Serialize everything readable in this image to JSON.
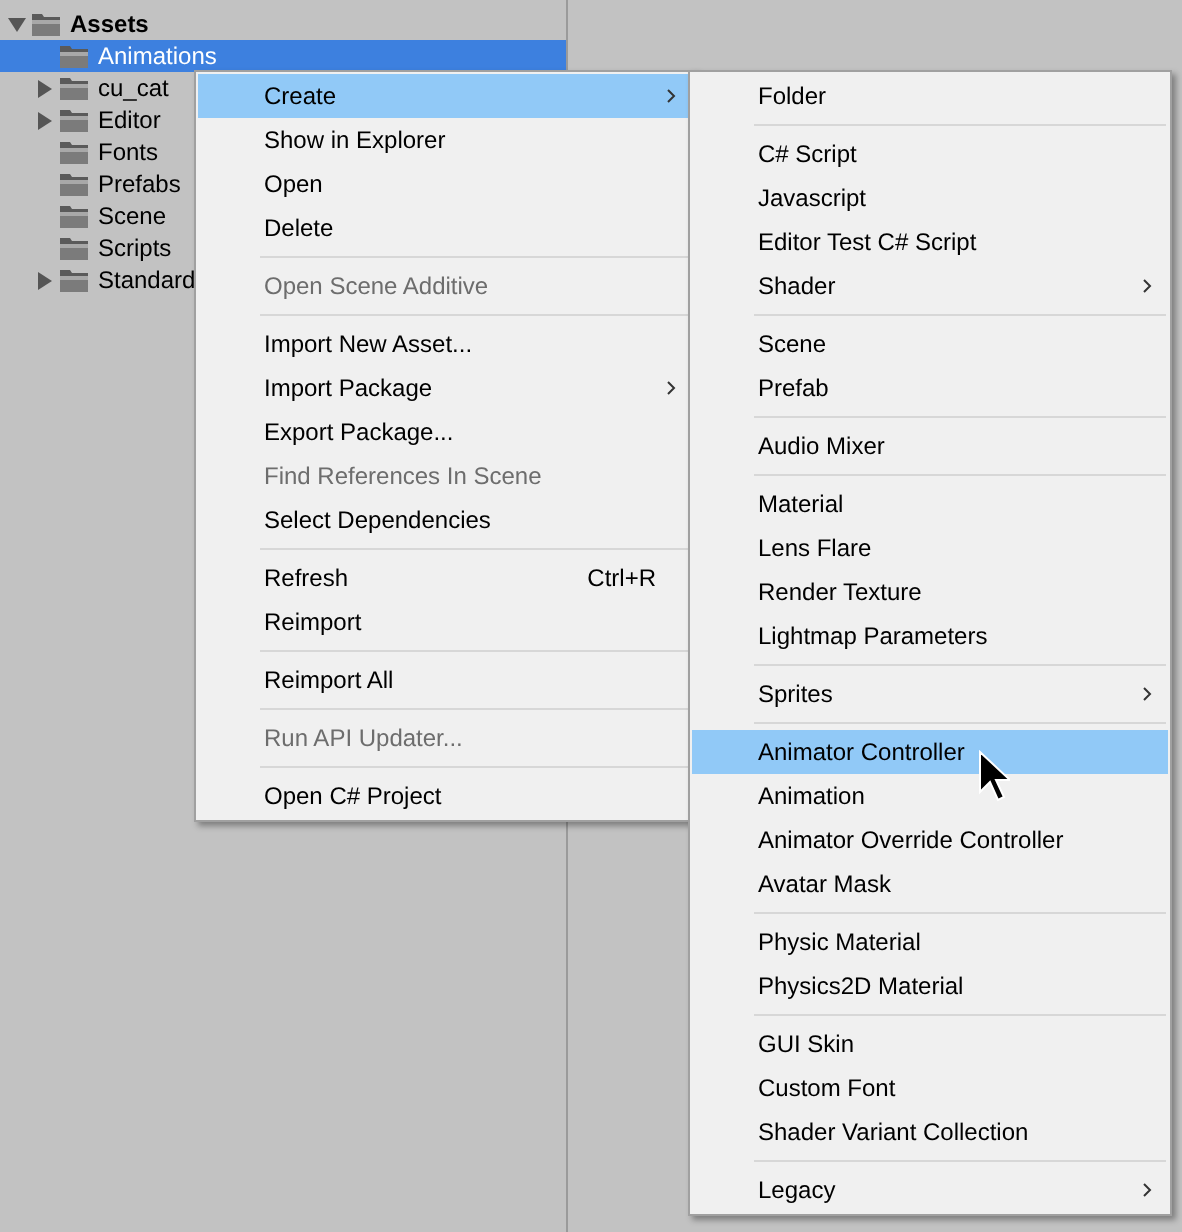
{
  "tree": [
    {
      "label": "Assets",
      "has_children": true,
      "expanded": true,
      "selected": false,
      "children": [
        {
          "label": "Animations",
          "has_children": false,
          "selected": true
        },
        {
          "label": "cu_cat",
          "has_children": true,
          "expanded": false,
          "selected": false
        },
        {
          "label": "Editor",
          "has_children": true,
          "expanded": false,
          "selected": false
        },
        {
          "label": "Fonts",
          "has_children": false,
          "selected": false
        },
        {
          "label": "Prefabs",
          "has_children": false,
          "selected": false
        },
        {
          "label": "Scene",
          "has_children": false,
          "selected": false
        },
        {
          "label": "Scripts",
          "has_children": false,
          "selected": false
        },
        {
          "label": "Standard",
          "has_children": true,
          "expanded": false,
          "selected": false
        }
      ]
    }
  ],
  "context_menu": {
    "items": [
      {
        "kind": "item",
        "label": "Create",
        "submenu": true,
        "disabled": false,
        "selected": true
      },
      {
        "kind": "item",
        "label": "Show in Explorer",
        "submenu": false,
        "disabled": false,
        "selected": false
      },
      {
        "kind": "item",
        "label": "Open",
        "submenu": false,
        "disabled": false,
        "selected": false
      },
      {
        "kind": "item",
        "label": "Delete",
        "submenu": false,
        "disabled": false,
        "selected": false
      },
      {
        "kind": "separator"
      },
      {
        "kind": "item",
        "label": "Open Scene Additive",
        "submenu": false,
        "disabled": true,
        "selected": false
      },
      {
        "kind": "separator"
      },
      {
        "kind": "item",
        "label": "Import New Asset...",
        "submenu": false,
        "disabled": false,
        "selected": false
      },
      {
        "kind": "item",
        "label": "Import Package",
        "submenu": true,
        "disabled": false,
        "selected": false
      },
      {
        "kind": "item",
        "label": "Export Package...",
        "submenu": false,
        "disabled": false,
        "selected": false
      },
      {
        "kind": "item",
        "label": "Find References In Scene",
        "submenu": false,
        "disabled": true,
        "selected": false
      },
      {
        "kind": "item",
        "label": "Select Dependencies",
        "submenu": false,
        "disabled": false,
        "selected": false
      },
      {
        "kind": "separator"
      },
      {
        "kind": "item",
        "label": "Refresh",
        "shortcut": "Ctrl+R",
        "submenu": false,
        "disabled": false,
        "selected": false
      },
      {
        "kind": "item",
        "label": "Reimport",
        "submenu": false,
        "disabled": false,
        "selected": false
      },
      {
        "kind": "separator"
      },
      {
        "kind": "item",
        "label": "Reimport All",
        "submenu": false,
        "disabled": false,
        "selected": false
      },
      {
        "kind": "separator"
      },
      {
        "kind": "item",
        "label": "Run API Updater...",
        "submenu": false,
        "disabled": true,
        "selected": false
      },
      {
        "kind": "separator"
      },
      {
        "kind": "item",
        "label": "Open C# Project",
        "submenu": false,
        "disabled": false,
        "selected": false
      }
    ]
  },
  "create_submenu": {
    "items": [
      {
        "kind": "item",
        "label": "Folder",
        "submenu": false,
        "disabled": false,
        "selected": false
      },
      {
        "kind": "separator"
      },
      {
        "kind": "item",
        "label": "C# Script",
        "submenu": false,
        "disabled": false,
        "selected": false
      },
      {
        "kind": "item",
        "label": "Javascript",
        "submenu": false,
        "disabled": false,
        "selected": false
      },
      {
        "kind": "item",
        "label": "Editor Test C# Script",
        "submenu": false,
        "disabled": false,
        "selected": false
      },
      {
        "kind": "item",
        "label": "Shader",
        "submenu": true,
        "disabled": false,
        "selected": false
      },
      {
        "kind": "separator"
      },
      {
        "kind": "item",
        "label": "Scene",
        "submenu": false,
        "disabled": false,
        "selected": false
      },
      {
        "kind": "item",
        "label": "Prefab",
        "submenu": false,
        "disabled": false,
        "selected": false
      },
      {
        "kind": "separator"
      },
      {
        "kind": "item",
        "label": "Audio Mixer",
        "submenu": false,
        "disabled": false,
        "selected": false
      },
      {
        "kind": "separator"
      },
      {
        "kind": "item",
        "label": "Material",
        "submenu": false,
        "disabled": false,
        "selected": false
      },
      {
        "kind": "item",
        "label": "Lens Flare",
        "submenu": false,
        "disabled": false,
        "selected": false
      },
      {
        "kind": "item",
        "label": "Render Texture",
        "submenu": false,
        "disabled": false,
        "selected": false
      },
      {
        "kind": "item",
        "label": "Lightmap Parameters",
        "submenu": false,
        "disabled": false,
        "selected": false
      },
      {
        "kind": "separator"
      },
      {
        "kind": "item",
        "label": "Sprites",
        "submenu": true,
        "disabled": false,
        "selected": false
      },
      {
        "kind": "separator"
      },
      {
        "kind": "item",
        "label": "Animator Controller",
        "submenu": false,
        "disabled": false,
        "selected": true
      },
      {
        "kind": "item",
        "label": "Animation",
        "submenu": false,
        "disabled": false,
        "selected": false
      },
      {
        "kind": "item",
        "label": "Animator Override Controller",
        "submenu": false,
        "disabled": false,
        "selected": false
      },
      {
        "kind": "item",
        "label": "Avatar Mask",
        "submenu": false,
        "disabled": false,
        "selected": false
      },
      {
        "kind": "separator"
      },
      {
        "kind": "item",
        "label": "Physic Material",
        "submenu": false,
        "disabled": false,
        "selected": false
      },
      {
        "kind": "item",
        "label": "Physics2D Material",
        "submenu": false,
        "disabled": false,
        "selected": false
      },
      {
        "kind": "separator"
      },
      {
        "kind": "item",
        "label": "GUI Skin",
        "submenu": false,
        "disabled": false,
        "selected": false
      },
      {
        "kind": "item",
        "label": "Custom Font",
        "submenu": false,
        "disabled": false,
        "selected": false
      },
      {
        "kind": "item",
        "label": "Shader Variant Collection",
        "submenu": false,
        "disabled": false,
        "selected": false
      },
      {
        "kind": "separator"
      },
      {
        "kind": "item",
        "label": "Legacy",
        "submenu": true,
        "disabled": false,
        "selected": false
      }
    ]
  }
}
